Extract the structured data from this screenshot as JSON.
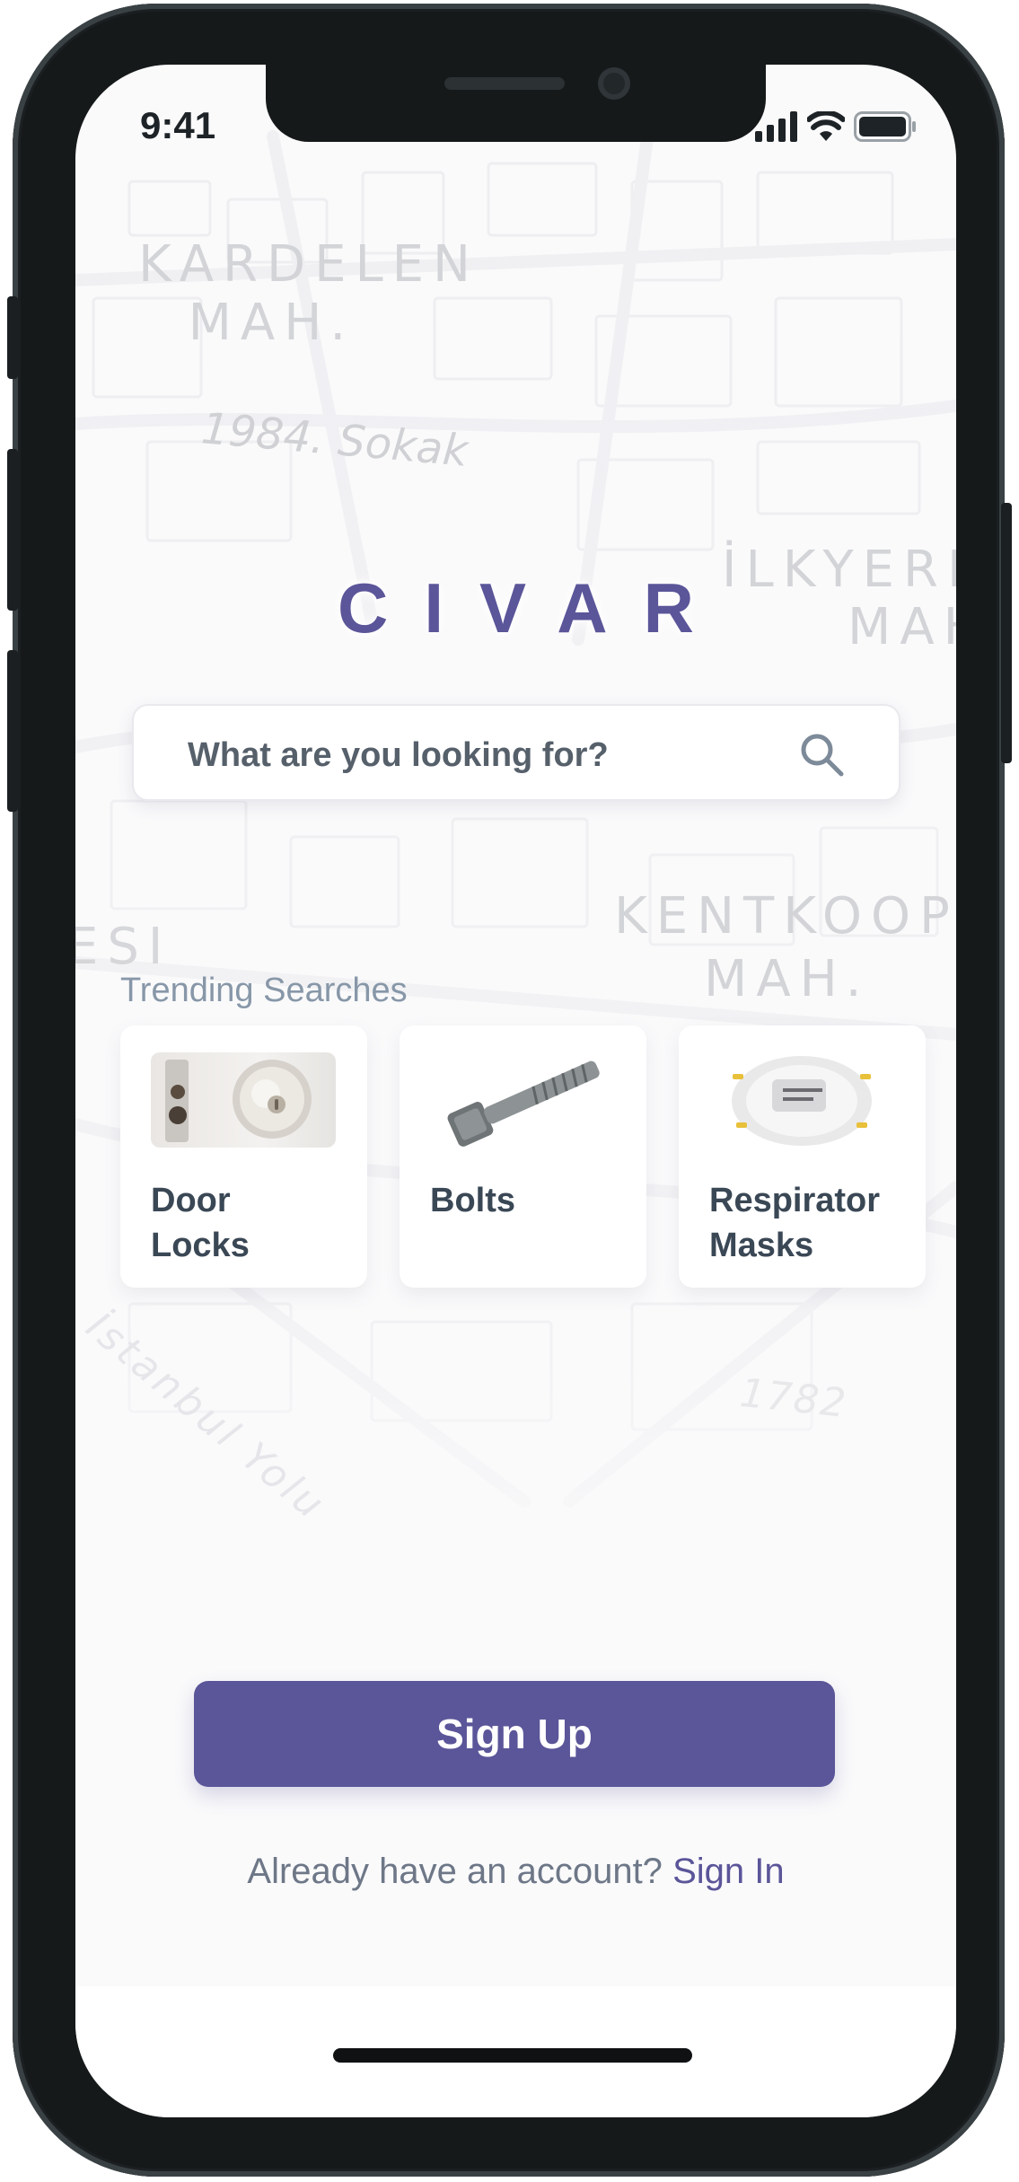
{
  "status_bar": {
    "time": "9:41",
    "icons": [
      "signal-icon",
      "wifi-icon",
      "battery-icon"
    ]
  },
  "map": {
    "labels": [
      "KARDELEN\n  MAH.",
      "1984. Sokak",
      "İLKYERL",
      "MAH",
      "KENTKOOP",
      "MAH.",
      "ESI",
      "İstanbul Yolu",
      "1782"
    ]
  },
  "app": {
    "logo": "CIVAR",
    "search": {
      "placeholder": "What are you looking for?",
      "icon": "search-icon"
    },
    "trending": {
      "title": "Trending Searches",
      "items": [
        {
          "label": "Door\nLocks",
          "icon": "door-lock-image"
        },
        {
          "label": "Bolts",
          "icon": "bolt-image"
        },
        {
          "label": "Respirator\nMasks",
          "icon": "respirator-mask-image"
        }
      ]
    },
    "signup_label": "Sign Up",
    "signin_prompt": "Already have an account?",
    "signin_link": "Sign In"
  },
  "colors": {
    "accent": "#5b5599",
    "text_dark": "#3a4755",
    "text_muted": "#8797a8",
    "phone_frame": "#16191a"
  }
}
